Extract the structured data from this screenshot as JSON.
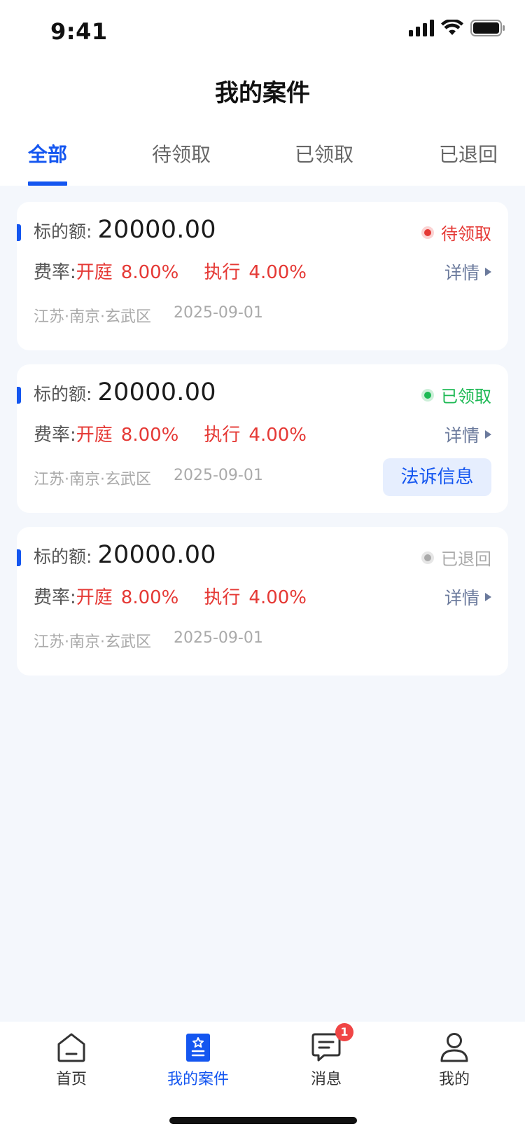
{
  "status_bar": {
    "time": "9:41"
  },
  "header": {
    "title": "我的案件"
  },
  "tabs": [
    {
      "label": "全部",
      "active": true
    },
    {
      "label": "待领取",
      "active": false
    },
    {
      "label": "已领取",
      "active": false
    },
    {
      "label": "已退回",
      "active": false
    }
  ],
  "cards": [
    {
      "amount_label": "标的额:",
      "amount": "20000.00",
      "status": "待领取",
      "status_color": "#E53935",
      "rate_label": "费率:",
      "trial_label": "开庭",
      "trial_rate": "8.00%",
      "exec_label": "执行",
      "exec_rate": "4.00%",
      "detail_label": "详情",
      "location": "江苏·南京·玄武区",
      "date": "2025-09-01"
    },
    {
      "amount_label": "标的额:",
      "amount": "20000.00",
      "status": "已领取",
      "status_color": "#1DB954",
      "rate_label": "费率:",
      "trial_label": "开庭",
      "trial_rate": "8.00%",
      "exec_label": "执行",
      "exec_rate": "4.00%",
      "detail_label": "详情",
      "location": "江苏·南京·玄武区",
      "date": "2025-09-01",
      "action_label": "法诉信息"
    },
    {
      "amount_label": "标的额:",
      "amount": "20000.00",
      "status": "已退回",
      "status_color": "#AAAAAA",
      "rate_label": "费率:",
      "trial_label": "开庭",
      "trial_rate": "8.00%",
      "exec_label": "执行",
      "exec_rate": "4.00%",
      "detail_label": "详情",
      "location": "江苏·南京·玄武区",
      "date": "2025-09-01"
    }
  ],
  "tabbar": {
    "items": [
      {
        "label": "首页",
        "icon": "home-icon",
        "active": false
      },
      {
        "label": "我的案件",
        "icon": "case-icon",
        "active": true
      },
      {
        "label": "消息",
        "icon": "message-icon",
        "active": false,
        "badge": "1"
      },
      {
        "label": "我的",
        "icon": "profile-icon",
        "active": false
      }
    ]
  },
  "colors": {
    "accent": "#1456F0",
    "red": "#E53935",
    "green": "#1DB954",
    "gray": "#AAAAAA",
    "background": "#F4F7FC"
  }
}
